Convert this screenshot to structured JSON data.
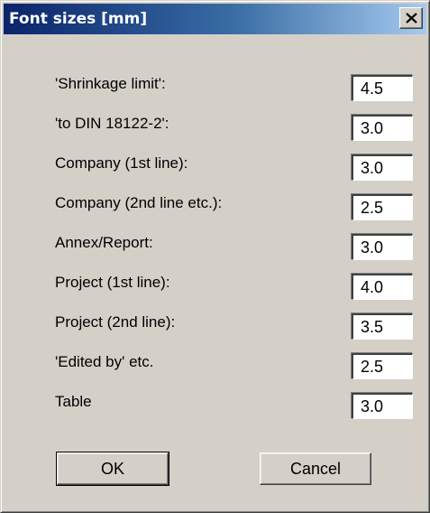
{
  "dialog": {
    "title": "Font sizes [mm]"
  },
  "fields": [
    {
      "label": "'Shrinkage limit':",
      "value": "4.5"
    },
    {
      "label": "'to DIN 18122-2':",
      "value": "3.0"
    },
    {
      "label": "Company (1st line):",
      "value": "3.0"
    },
    {
      "label": "Company (2nd line etc.):",
      "value": "2.5"
    },
    {
      "label": "Annex/Report:",
      "value": "3.0"
    },
    {
      "label": "Project (1st line):",
      "value": "4.0"
    },
    {
      "label": "Project (2nd line):",
      "value": "3.5"
    },
    {
      "label": "'Edited by' etc.",
      "value": "2.5"
    },
    {
      "label": "Table",
      "value": "3.0"
    }
  ],
  "buttons": {
    "ok_label": "OK",
    "cancel_label": "Cancel"
  },
  "icons": {
    "close": "close-icon"
  },
  "colors": {
    "title_bar_start": "#0a246a",
    "title_bar_end": "#a6caf0",
    "dialog_face": "#d4d0c8"
  }
}
